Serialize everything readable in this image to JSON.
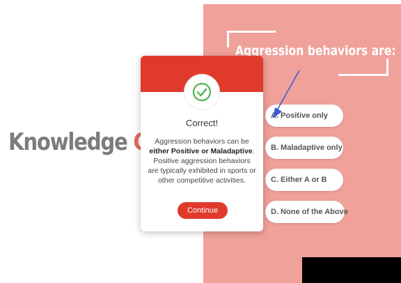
{
  "page": {
    "title_part1": "Knowledge ",
    "title_part2": "Che",
    "question": "Aggression behaviors are:"
  },
  "options": [
    {
      "label": "A. Positive only"
    },
    {
      "label": "B. Maladaptive only"
    },
    {
      "label": "C. Either A or B"
    },
    {
      "label": "D. None of the Above"
    }
  ],
  "modal": {
    "icon": "check-circle-icon",
    "title": "Correct!",
    "body_line1": "Aggression behaviors can be",
    "body_bold": "either Positive or Maladaptive",
    "body_period": ".",
    "body_rest": "Positive aggression behaviors are typically exhibited in sports or other competitive activities.",
    "continue_label": "Continue"
  },
  "colors": {
    "accent_red": "#e03a2c",
    "panel_pink": "#f0a199",
    "check_green": "#5cb85c",
    "arrow_blue": "#3b5bd6"
  }
}
